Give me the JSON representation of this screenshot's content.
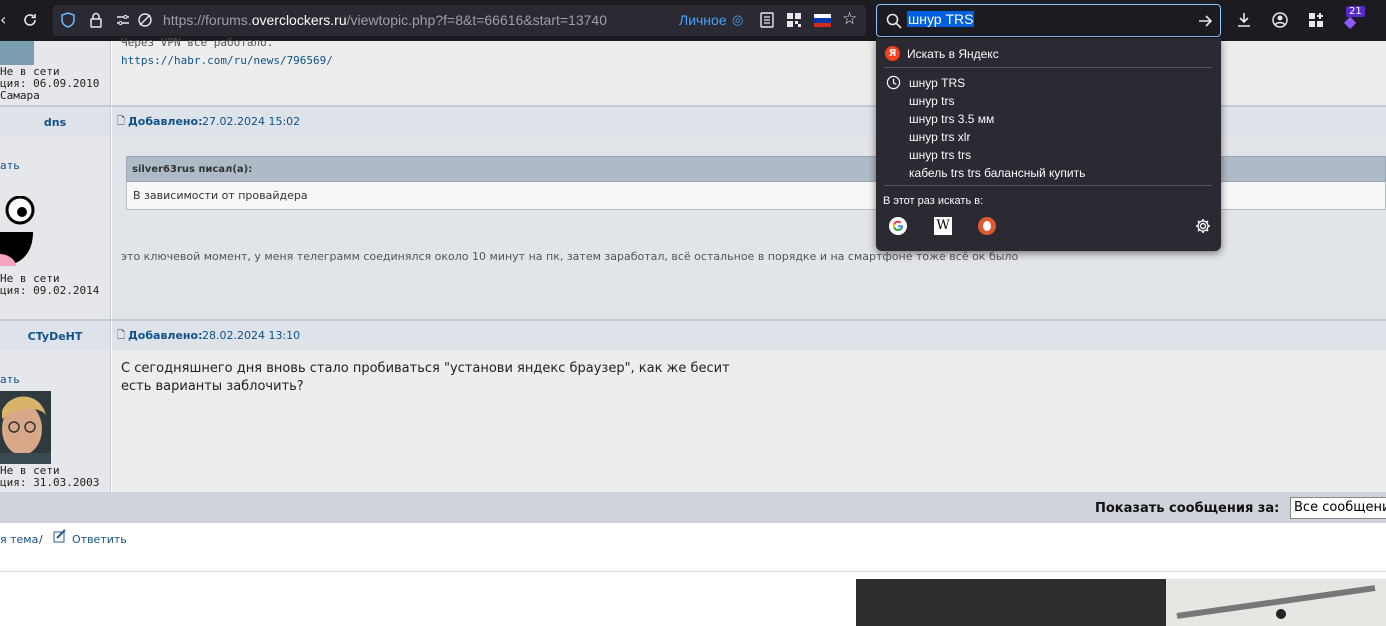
{
  "browser": {
    "url_prefix": "https://forums.",
    "url_domain": "overclockers.ru",
    "url_suffix": "/viewtopic.php?f=8&t=66616&start=13740",
    "personal_label": "Личное",
    "search_query": "шнур TRS",
    "extensions_badge": "21"
  },
  "search_dropdown": {
    "yandex_label": "Искать в Яндекс",
    "history": [
      "шнур TRS",
      "шнур trs",
      "шнур trs 3.5 мм",
      "шнур trs xlr",
      "шнур trs trs",
      "кабель trs trs балансный купить"
    ],
    "search_with_label": "В этот раз искать в:"
  },
  "posts": [
    {
      "status": "Не в сети",
      "reg": "ция: 06.09.2010",
      "city": "Самара",
      "text_line1": "Через VPN все работало.",
      "link": "https://habr.com/ru/news/796569/"
    },
    {
      "author": "dns",
      "added_label": "Добавлено:",
      "added_date": "27.02.2024 15:02",
      "action": "ать",
      "quote_author": "silver63rus писал(а):",
      "quote_text": "В зависимости от провайдера",
      "text": "это ключевой момент, у меня телеграмм соединялся около 10 минут на пк, затем заработал, всё остальное в порядке и на смартфоне тоже всё ок было",
      "status": "Не в сети",
      "reg": "ция: 09.02.2014"
    },
    {
      "author": "CTyDeHT",
      "added_label": "Добавлено:",
      "added_date": "28.02.2024 13:10",
      "action": "ать",
      "text_line1": "С сегодняшнего дня вновь стало пробиваться \"установи яндекс браузер\", как же бесит",
      "text_line2": "есть варианты заблочить?",
      "status": "Не в сети",
      "reg": "ция: 31.03.2003"
    }
  ],
  "footer": {
    "show_messages_label": "Показать сообщения за:",
    "show_messages_value": "Все сообщени",
    "new_topic": "я тема",
    "slash": "/",
    "reply": "Ответить"
  }
}
